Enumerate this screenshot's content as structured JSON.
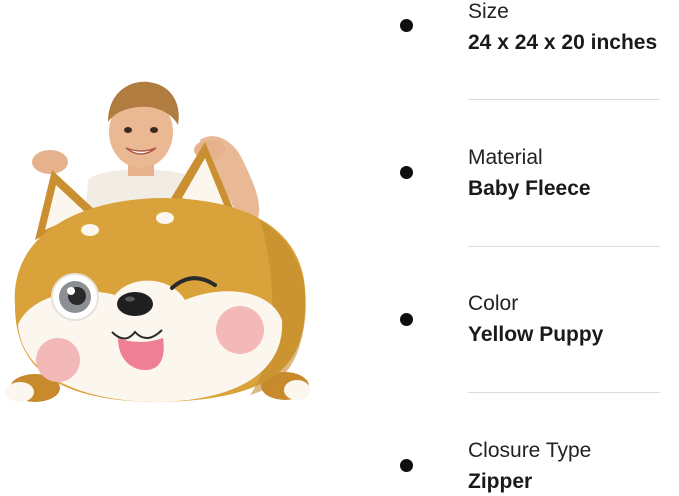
{
  "specs": [
    {
      "label": "Size",
      "value": "24 x 24 x 20 inches"
    },
    {
      "label": "Material",
      "value": "Baby Fleece"
    },
    {
      "label": "Color",
      "value": "Yellow Puppy"
    },
    {
      "label": "Closure Type",
      "value": "Zipper"
    }
  ],
  "colors": {
    "fur": "#d9a23a",
    "fur_dark": "#b9822a",
    "cream": "#fbf6ee",
    "cheek": "#f3b8b8",
    "tongue": "#ef7f95",
    "text": "#222222",
    "divider": "#dcdcdc"
  }
}
